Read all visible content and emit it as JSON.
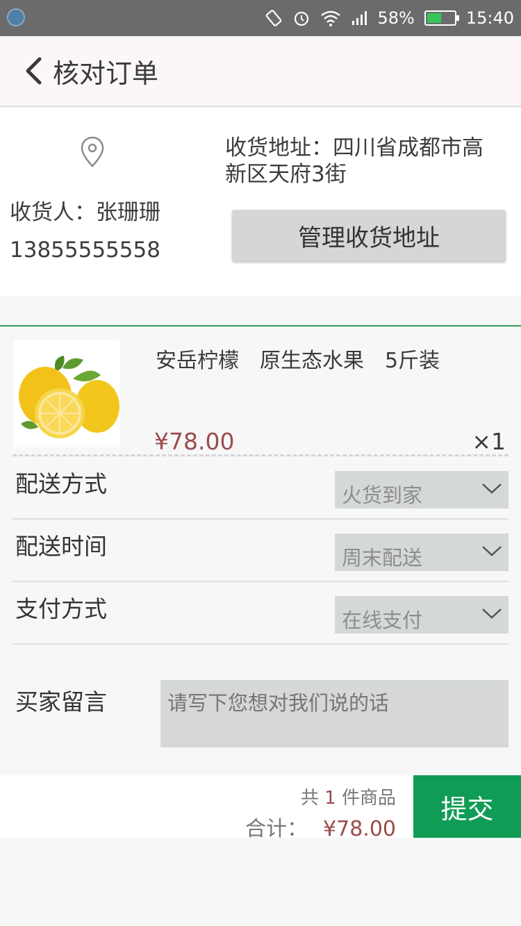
{
  "status_bar": {
    "battery_percent": "58%",
    "battery_level": 0.58,
    "time": "15:40",
    "battery_color": "#35c35a"
  },
  "header": {
    "title": "核对订单",
    "back_icon": "chevron-left-icon"
  },
  "address": {
    "pin_icon": "location-pin-icon",
    "receiver": "收货人：张珊珊",
    "phone": "13855555558",
    "address_text": "收货地址：四川省成都市高新区天府3街",
    "manage_button": "管理收货地址"
  },
  "product": {
    "name": "安岳柠檬　原生态水果　5斤装",
    "price": "¥78.00",
    "quantity": "×1",
    "image": "lemon-image"
  },
  "options": [
    {
      "label": "配送方式",
      "value": "火货到家"
    },
    {
      "label": "配送时间",
      "value": "周末配送"
    },
    {
      "label": "支付方式",
      "value": "在线支付"
    }
  ],
  "message": {
    "label": "买家留言",
    "placeholder": "请写下您想对我们说的话"
  },
  "footer": {
    "count_prefix": "共",
    "count": "1",
    "count_suffix": "件商品",
    "total_label": "合计：",
    "total": "¥78.00",
    "submit": "提交",
    "accent_color": "#109c55",
    "price_color": "#9a4b4b"
  }
}
